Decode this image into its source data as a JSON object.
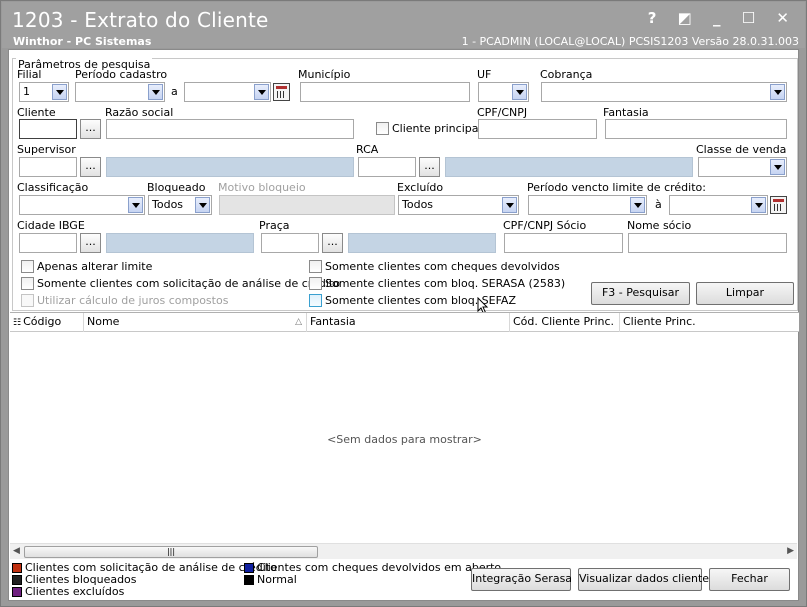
{
  "window": {
    "title": "1203 - Extrato do Cliente",
    "subtitle": "Winthor - PC Sistemas",
    "info": "1 - PCADMIN (LOCAL@LOCAL)   PCSIS1203  Versão  28.0.31.003",
    "controls": "? ◩ _ ☐ ✕"
  },
  "params": {
    "group_title": "Parâmetros de pesquisa",
    "filial_label": "Filial",
    "filial_value": "1",
    "periodo_label": "Período cadastro",
    "a_label": "a",
    "municipio_label": "Município",
    "uf_label": "UF",
    "cobranca_label": "Cobrança",
    "cliente_label": "Cliente",
    "razao_label": "Razão social",
    "cliente_principal_label": "Cliente principal",
    "cpf_label": "CPF/CNPJ",
    "fantasia_label": "Fantasia",
    "supervisor_label": "Supervisor",
    "rca_label": "RCA",
    "classe_venda_label": "Classe de venda",
    "classificacao_label": "Classificação",
    "bloqueado_label": "Bloqueado",
    "bloqueado_value": "Todos",
    "motivo_label": "Motivo bloqueio",
    "excluido_label": "Excluído",
    "excluido_value": "Todos",
    "periodo_vencto_label": "Período vencto limite de crédito:",
    "a2_label": "à",
    "cidade_label": "Cidade IBGE",
    "praca_label": "Praça",
    "cpf_socio_label": "CPF/CNPJ Sócio",
    "nome_socio_label": "Nome sócio",
    "dots": "..."
  },
  "checks": {
    "apenas_alterar": "Apenas alterar limite",
    "solicitacao": "Somente clientes com solicitação de análise de crédito",
    "juros": "Utilizar cálculo de juros compostos",
    "cheques": "Somente clientes com cheques devolvidos",
    "serasa": "Somente clientes com bloq. SERASA (2583)",
    "sefaz": "Somente clientes com bloq. SEFAZ"
  },
  "buttons": {
    "pesquisar": "F3 - Pesquisar",
    "limpar": "Limpar",
    "integracao": "Integração Serasa",
    "visualizar": "Visualizar dados cliente",
    "fechar": "Fechar"
  },
  "grid": {
    "columns": [
      "Código",
      "Nome",
      "Fantasia",
      "Cód. Cliente Princ.",
      "Cliente Princ."
    ],
    "empty_text": "<Sem dados para mostrar>",
    "sort_indicator": "△",
    "menu_glyph": "☷"
  },
  "legend": {
    "items": [
      {
        "label": "Clientes com solicitação de análise de crédito",
        "color": "#c03010"
      },
      {
        "label": "Clientes com cheques devolvidos em aberto",
        "color": "#1020a0"
      },
      {
        "label": "Clientes bloqueados",
        "color": "#202020"
      },
      {
        "label": "Normal",
        "color": "#000000"
      },
      {
        "label": "Clientes excluídos",
        "color": "#702080"
      }
    ]
  }
}
